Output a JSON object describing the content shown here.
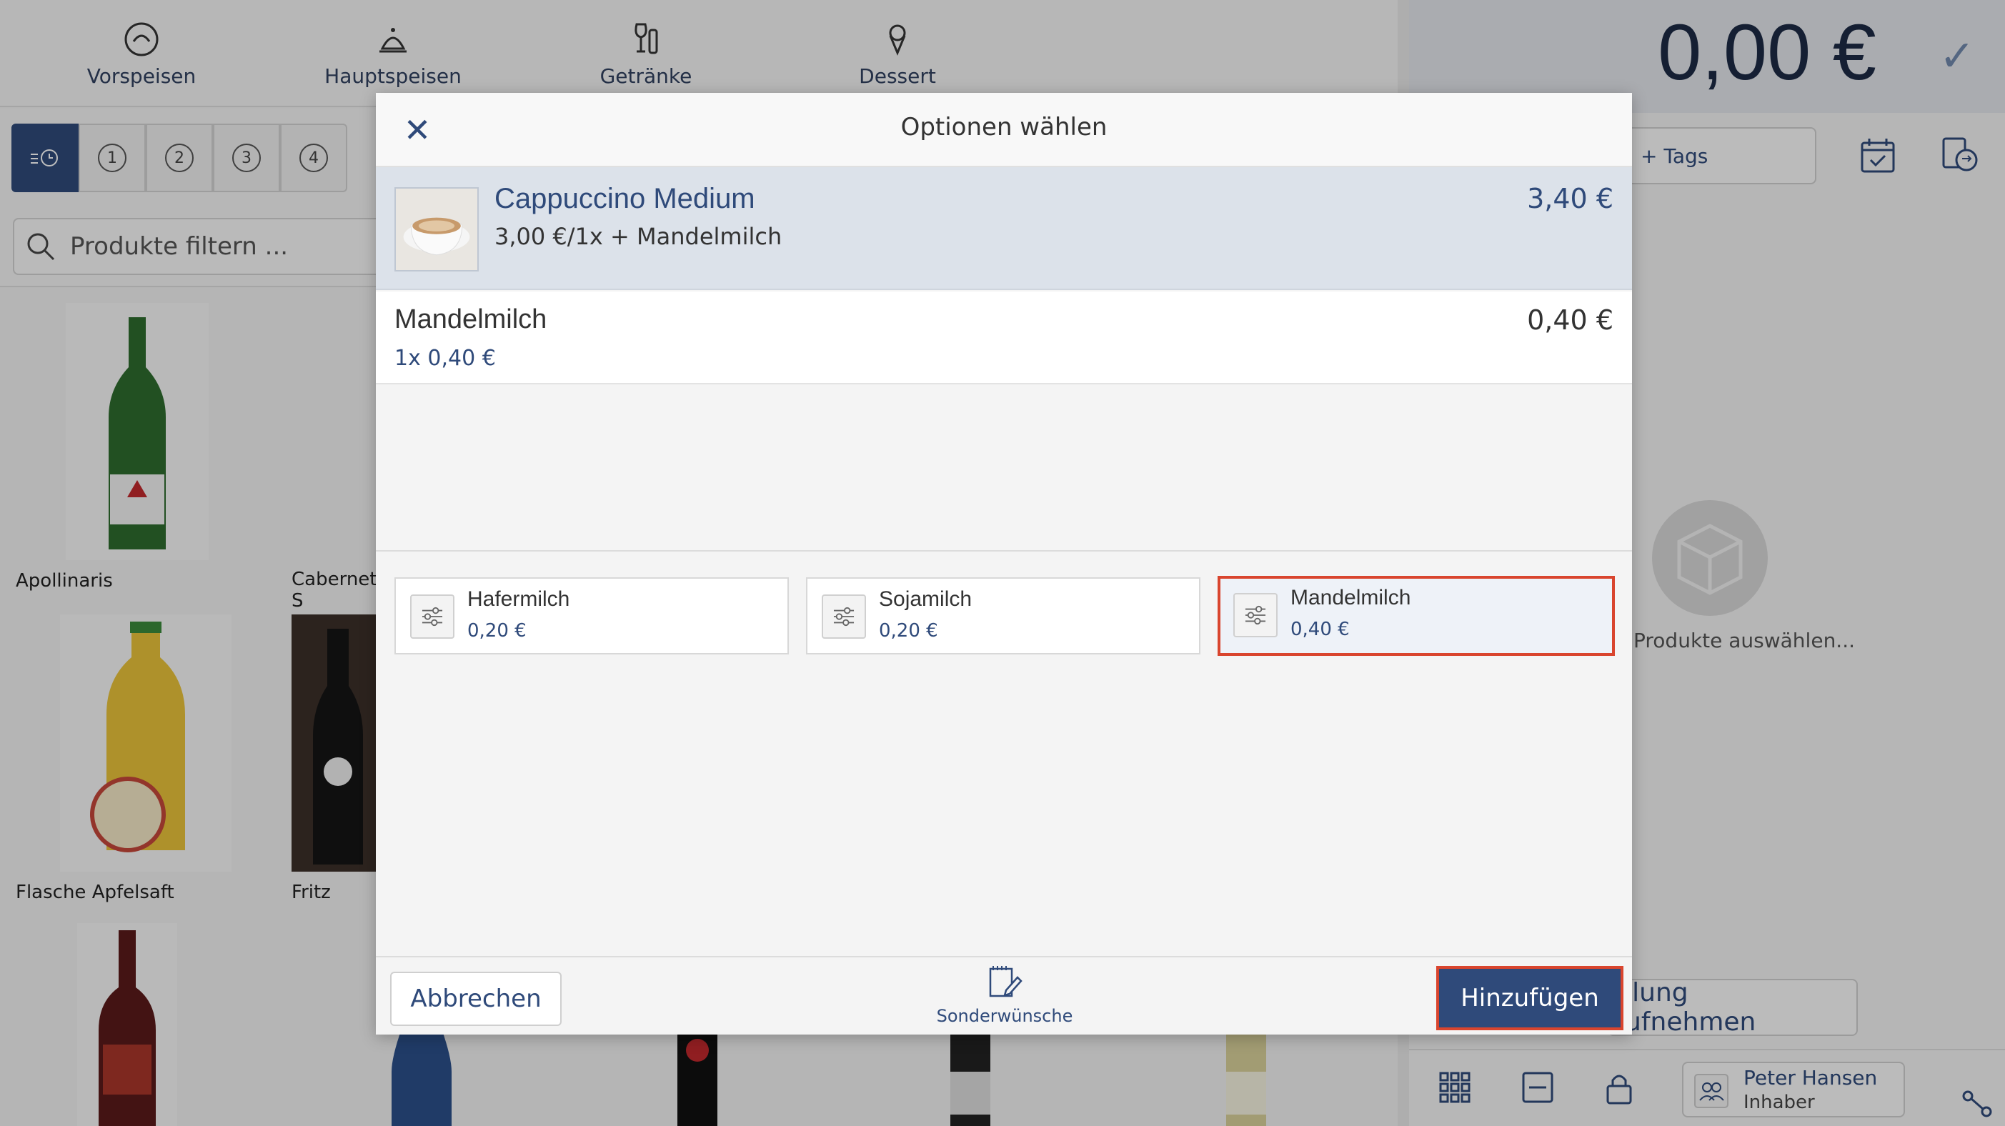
{
  "categories": [
    {
      "label": "Vorspeisen",
      "icon": "starter-plate-icon"
    },
    {
      "label": "Hauptspeisen",
      "icon": "cloche-icon"
    },
    {
      "label": "Getränke",
      "icon": "drinks-icon"
    },
    {
      "label": "Dessert",
      "icon": "ice-cream-icon"
    }
  ],
  "filter": {
    "segments": [
      "1",
      "2",
      "3",
      "4"
    ],
    "search_placeholder": "Produkte filtern ..."
  },
  "products": [
    {
      "name": "Apollinaris"
    },
    {
      "name": "Cabernet S"
    },
    {
      "name": "Flasche Apfelsaft"
    },
    {
      "name": "Fritz"
    }
  ],
  "order": {
    "total": "0,00 €",
    "tags_label": "+ Tags",
    "empty_text": "Produkte auswählen...",
    "take_order_label": "ellung aufnehmen",
    "user_name": "Peter Hansen",
    "user_role": "Inhaber"
  },
  "modal": {
    "title": "Optionen wählen",
    "product": {
      "name": "Cappuccino Medium",
      "detail": "3,00 €/1x + Mandelmilch",
      "price": "3,40 €"
    },
    "selected_option": {
      "name": "Mandelmilch",
      "detail": "1x 0,40 €",
      "price": "0,40 €"
    },
    "options": [
      {
        "name": "Hafermilch",
        "price": "0,20 €",
        "selected": false
      },
      {
        "name": "Sojamilch",
        "price": "0,20 €",
        "selected": false
      },
      {
        "name": "Mandelmilch",
        "price": "0,40 €",
        "selected": true
      }
    ],
    "cancel_label": "Abbrechen",
    "special_label": "Sonderwünsche",
    "add_label": "Hinzufügen"
  },
  "colors": {
    "primary": "#2f4a7a",
    "highlight_border": "#d9452e",
    "product_row_bg": "#dce2ea"
  }
}
